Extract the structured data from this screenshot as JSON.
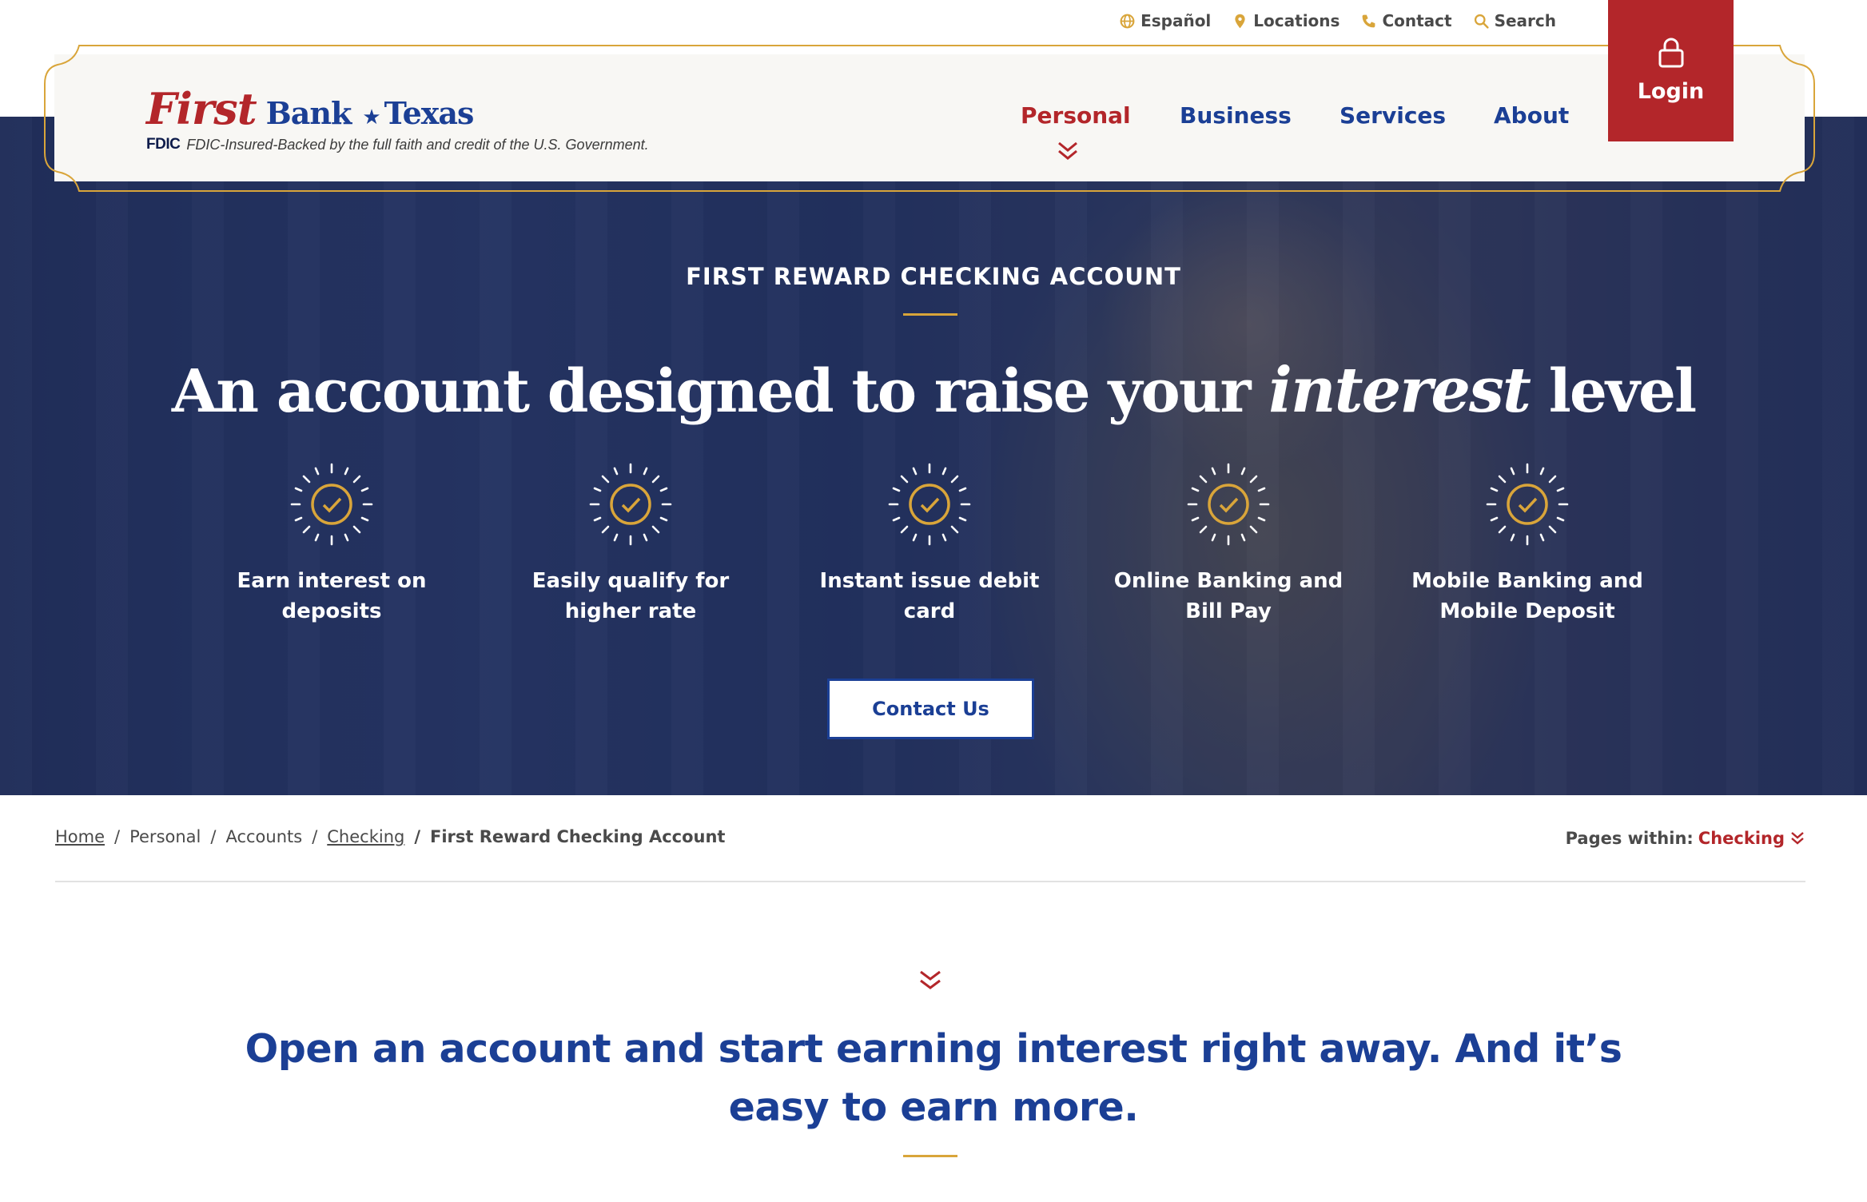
{
  "utility_nav": [
    {
      "label": "Español",
      "icon": "globe-icon"
    },
    {
      "label": "Locations",
      "icon": "map-pin-icon"
    },
    {
      "label": "Contact",
      "icon": "phone-icon"
    },
    {
      "label": "Search",
      "icon": "search-icon"
    }
  ],
  "brand": {
    "first": "First",
    "bank": "Bank",
    "star": "★",
    "texas": "Texas",
    "fdic_badge": "FDIC",
    "fdic_text": "FDIC-Insured-Backed by the full faith and credit of the U.S. Government."
  },
  "main_nav": {
    "personal": "Personal",
    "business": "Business",
    "services": "Services",
    "about": "About",
    "active": "Personal"
  },
  "login": {
    "label": "Login",
    "icon": "lock-icon"
  },
  "hero": {
    "eyebrow": "FIRST REWARD CHECKING ACCOUNT",
    "headline_before": "An account designed to raise your ",
    "headline_script": "interest",
    "headline_after": " level",
    "features": [
      "Earn interest on deposits",
      "Easily qualify for higher rate",
      "Instant issue debit card",
      "Online Banking and Bill Pay",
      "Mobile Banking and Mobile Deposit"
    ],
    "cta": "Contact Us"
  },
  "breadcrumb": {
    "home": "Home",
    "personal": "Personal",
    "accounts": "Accounts",
    "checking": "Checking",
    "current": "First Reward Checking Account",
    "sep": "/"
  },
  "pages_within": {
    "label": "Pages within:",
    "value": "Checking"
  },
  "intro": {
    "text": "Open an account and start earning interest right away. And it’s easy to earn more."
  },
  "colors": {
    "brand_red": "#b3262a",
    "brand_blue": "#1b3f95",
    "gold": "#d9a53a",
    "header_bg": "#f8f7f4"
  }
}
